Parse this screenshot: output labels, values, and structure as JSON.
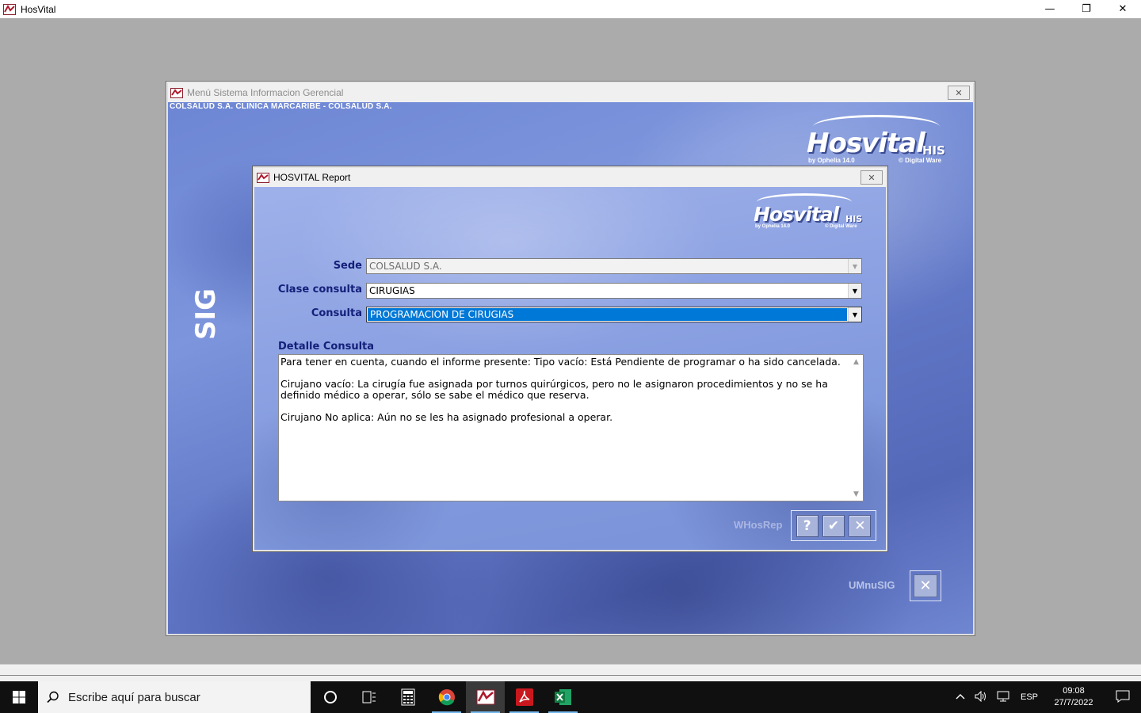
{
  "app": {
    "title": "HosVital",
    "controls": {
      "minimize": "—",
      "restore": "❐",
      "close": "✕"
    }
  },
  "sig_window": {
    "title": "Menú Sistema Informacion Gerencial",
    "company": "COLSALUD S.A. CLINICA MARCARIBE - COLSALUD S.A.",
    "vertical_label": "SIG",
    "logo": {
      "word": "Hosvital",
      "suffix": "HIS",
      "by": "by Ophelia 14.0",
      "copyright": "© Digital Ware"
    },
    "form_name": "UMnuSIG",
    "close_glyph": "✕"
  },
  "dialog": {
    "title": "HOSVITAL Report",
    "close_glyph": "✕",
    "logo": {
      "word": "Hosvital",
      "suffix": "HIS",
      "by": "by Ophelia 14.0",
      "copyright": "© Digital Ware"
    },
    "fields": {
      "sede": {
        "label": "Sede",
        "value": "COLSALUD S.A."
      },
      "clase_consulta": {
        "label": "Clase consulta",
        "value": "CIRUGIAS"
      },
      "consulta": {
        "label": "Consulta",
        "value": "PROGRAMACION DE CIRUGIAS"
      }
    },
    "detail": {
      "label": "Detalle Consulta",
      "paragraphs": [
        "Para tener en cuenta, cuando el informe presente: Tipo vacío: Está Pendiente de programar o ha sido cancelada.",
        "Cirujano vacío: La cirugía fue asignada por turnos quirúrgicos, pero no le asignaron procedimientos y no se ha definido médico a operar, sólo se sabe el médico que reserva.",
        "Cirujano No aplica: Aún no se les ha asignado profesional a operar."
      ]
    },
    "form_name": "WHosRep",
    "buttons": {
      "help": "?",
      "accept": "✔",
      "cancel": "✕"
    }
  },
  "taskbar": {
    "search_placeholder": "Escribe aquí para buscar",
    "apps": [
      "cortana-icon",
      "task-view-icon",
      "calculator-icon",
      "chrome-icon",
      "hosvital-icon",
      "acrobat-icon",
      "excel-icon"
    ],
    "language": "ESP",
    "time": "09:08",
    "date": "27/7/2022"
  },
  "colors": {
    "label_navy": "#14207a",
    "selection_blue": "#0078d7",
    "canvas_blue": "#7d95dc"
  }
}
